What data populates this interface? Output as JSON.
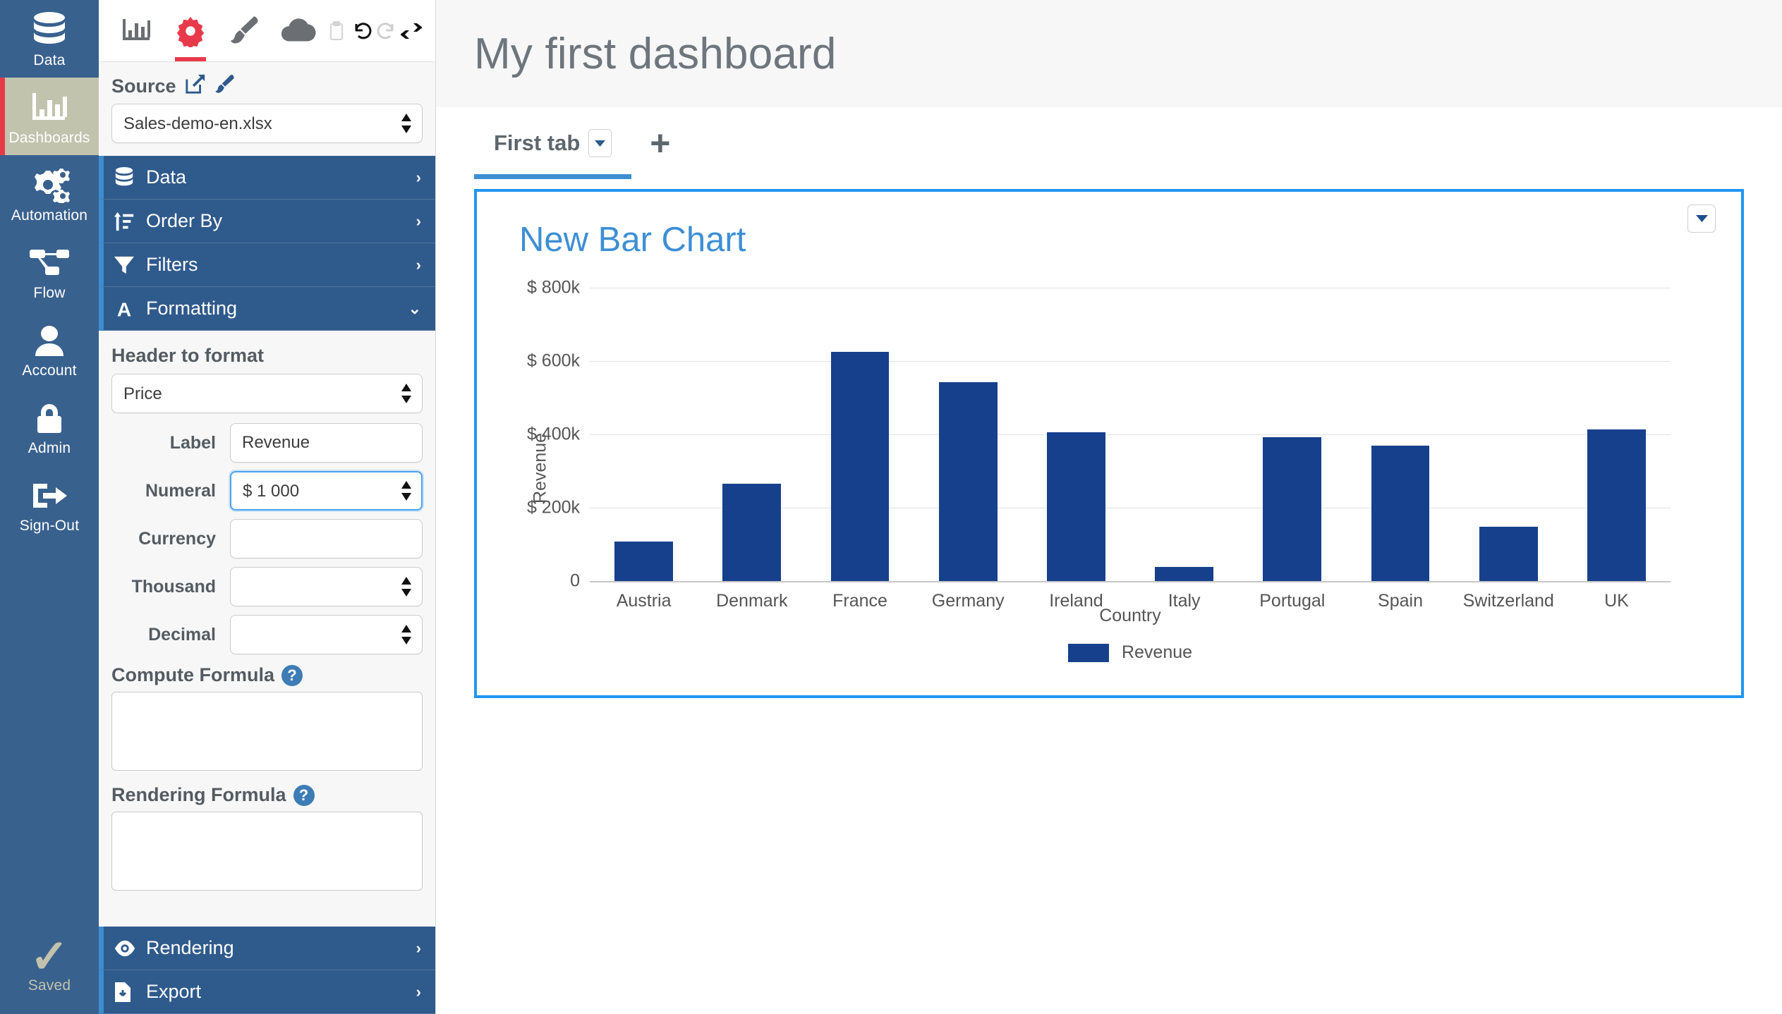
{
  "rail": {
    "items": [
      {
        "label": "Data",
        "icon": "database-icon",
        "active": false
      },
      {
        "label": "Dashboards",
        "icon": "bar-chart-icon",
        "active": true
      },
      {
        "label": "Automation",
        "icon": "gears-icon",
        "active": false
      },
      {
        "label": "Flow",
        "icon": "flow-icon",
        "active": false
      },
      {
        "label": "Account",
        "icon": "user-icon",
        "active": false
      },
      {
        "label": "Admin",
        "icon": "lock-icon",
        "active": false
      },
      {
        "label": "Sign-Out",
        "icon": "sign-out-icon",
        "active": false
      }
    ],
    "status": {
      "label": "Saved",
      "icon": "check-icon",
      "color": "#c2c3ad"
    }
  },
  "panel": {
    "toolbar": [
      {
        "name": "chart-tool",
        "icon": "bar-chart-icon",
        "selected": false
      },
      {
        "name": "settings-tool",
        "icon": "gear-icon",
        "selected": true
      },
      {
        "name": "style-tool",
        "icon": "paintbrush-icon",
        "selected": false
      },
      {
        "name": "cloud-tool",
        "icon": "cloud-icon",
        "selected": false
      }
    ],
    "toolbar_small": [
      {
        "name": "clipboard-button",
        "icon": "clipboard-icon",
        "enabled": false
      },
      {
        "name": "undo-button",
        "icon": "undo-icon",
        "enabled": true
      },
      {
        "name": "redo-button",
        "icon": "redo-icon",
        "enabled": false
      },
      {
        "name": "swap-button",
        "icon": "swap-icon",
        "enabled": true
      }
    ],
    "source": {
      "title": "Source",
      "edit_icon": "edit-square-icon",
      "brush_icon": "paintbrush-icon",
      "value": "Sales-demo-en.xlsx"
    },
    "nav": [
      {
        "label": "Data",
        "icon": "database-icon",
        "chevron": "›",
        "expanded": false
      },
      {
        "label": "Order By",
        "icon": "sort-icon",
        "chevron": "›",
        "expanded": false
      },
      {
        "label": "Filters",
        "icon": "funnel-icon",
        "chevron": "›",
        "expanded": false
      },
      {
        "label": "Formatting",
        "icon": "font-a-icon",
        "chevron": "⌄",
        "expanded": true
      }
    ],
    "formatting": {
      "section_title": "Header to format",
      "header_value": "Price",
      "fields": [
        {
          "label": "Label",
          "value": "Revenue",
          "type": "text",
          "focused": false
        },
        {
          "label": "Numeral",
          "value": "$ 1 000",
          "type": "select",
          "focused": true
        },
        {
          "label": "Currency",
          "value": "",
          "type": "text",
          "focused": false
        },
        {
          "label": "Thousand",
          "value": "",
          "type": "select",
          "focused": false
        },
        {
          "label": "Decimal",
          "value": "",
          "type": "select",
          "focused": false
        }
      ],
      "compute_formula": {
        "title": "Compute Formula",
        "help_icon": "help-circle-icon",
        "value": ""
      },
      "rendering_formula": {
        "title": "Rendering Formula",
        "help_icon": "help-circle-icon",
        "value": ""
      }
    },
    "nav_bottom": [
      {
        "label": "Rendering",
        "icon": "eye-icon",
        "chevron": "›"
      },
      {
        "label": "Export",
        "icon": "file-export-icon",
        "chevron": "›"
      }
    ]
  },
  "main": {
    "dashboard_title": "My first dashboard",
    "tabs": [
      {
        "label": "First tab",
        "active": true,
        "caret_icon": "caret-down-icon"
      }
    ],
    "add_tab_icon": "plus-icon",
    "card": {
      "menu_icon": "caret-down-icon",
      "border_color": "#2196f3"
    }
  },
  "chart_data": {
    "type": "bar",
    "title": "New Bar Chart",
    "categories": [
      "Austria",
      "Denmark",
      "France",
      "Germany",
      "Ireland",
      "Italy",
      "Portugal",
      "Spain",
      "Switzerland",
      "UK"
    ],
    "series": [
      {
        "name": "Revenue",
        "color": "#16408c",
        "values": [
          108000,
          265000,
          625000,
          543000,
          405000,
          39000,
          393000,
          369000,
          148000,
          413000
        ]
      }
    ],
    "xlabel": "Country",
    "ylabel": "Revenue",
    "ylim": [
      0,
      800000
    ],
    "yticks": [
      0,
      200000,
      400000,
      600000,
      800000
    ],
    "ytick_labels": [
      "0",
      "$ 200k",
      "$ 400k",
      "$ 600k",
      "$ 800k"
    ],
    "grid": true,
    "legend": {
      "position": "bottom",
      "entries": [
        "Revenue"
      ]
    }
  }
}
